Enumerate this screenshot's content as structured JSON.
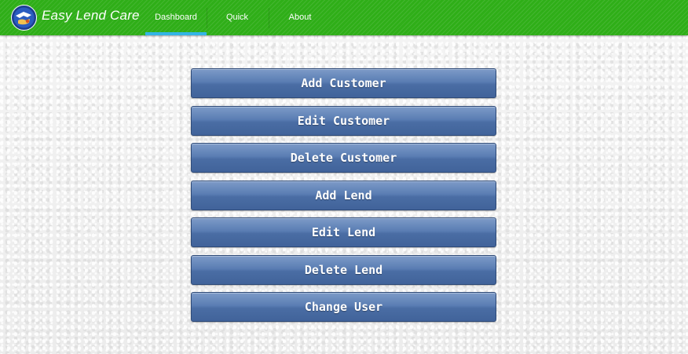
{
  "app": {
    "title": "Easy Lend Care",
    "logo_icon": "app-logo-icon"
  },
  "tabs": [
    {
      "label": "Dashboard",
      "selected": true
    },
    {
      "label": "Quick",
      "selected": false
    },
    {
      "label": "About",
      "selected": false
    }
  ],
  "menu": {
    "buttons": [
      {
        "label": "Add Customer"
      },
      {
        "label": "Edit Customer"
      },
      {
        "label": "Delete Customer"
      },
      {
        "label": "Add Lend"
      },
      {
        "label": "Edit Lend"
      },
      {
        "label": "Delete Lend"
      },
      {
        "label": "Change User"
      }
    ]
  },
  "colors": {
    "action_bar": "#2fae18",
    "tab_indicator": "#33b5e5",
    "button": "#4f72a9"
  }
}
